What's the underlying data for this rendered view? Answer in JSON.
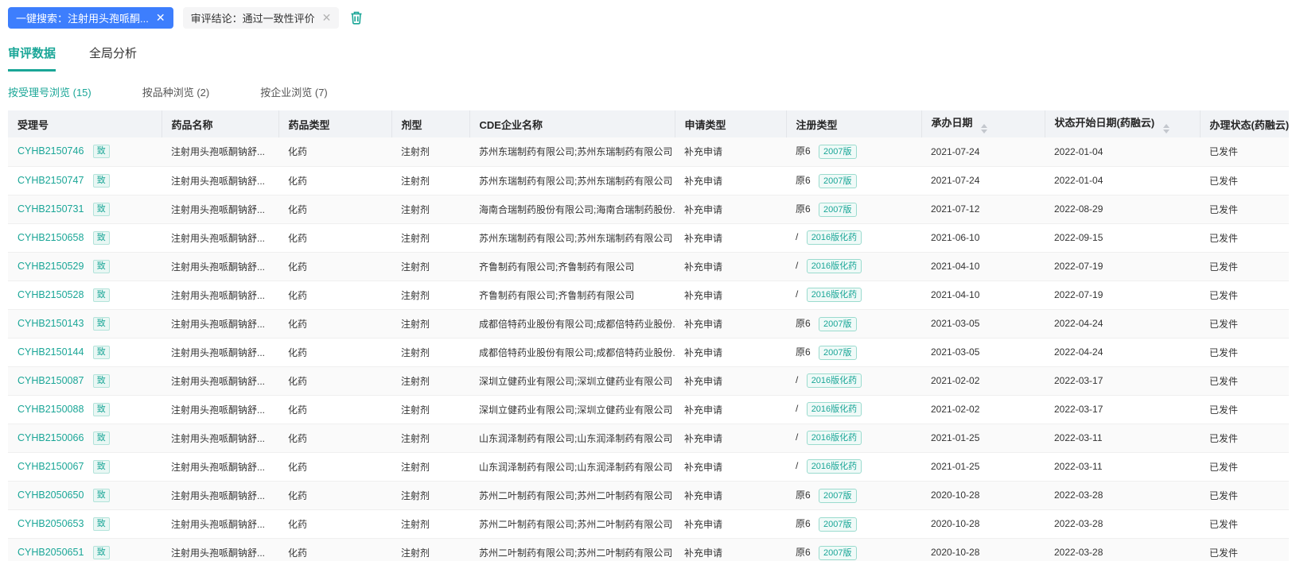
{
  "colors": {
    "accent_teal": "#1AA697",
    "accent_blue": "#3D7EFD"
  },
  "filter_bar": {
    "search_tag": {
      "label": "一键搜索：注射用头孢哌酮...",
      "close": "✕"
    },
    "condition_tag": {
      "label": "审评结论：通过一致性评价",
      "close": "✕"
    },
    "trash_icon": "delete-filters"
  },
  "tabs": [
    {
      "label": "审评数据",
      "active": true
    },
    {
      "label": "全局分析",
      "active": false
    }
  ],
  "subtabs": [
    {
      "label": "按受理号浏览 (15)",
      "active": true
    },
    {
      "label": "按品种浏览 (2)",
      "active": false
    },
    {
      "label": "按企业浏览 (7)",
      "active": false
    }
  ],
  "table": {
    "columns": [
      {
        "label": "受理号"
      },
      {
        "label": "药品名称"
      },
      {
        "label": "药品类型"
      },
      {
        "label": "剂型"
      },
      {
        "label": "CDE企业名称"
      },
      {
        "label": "申请类型"
      },
      {
        "label": "注册类型"
      },
      {
        "label": "承办日期",
        "sortable": true
      },
      {
        "label": "状态开始日期(药融云)",
        "sortable": true
      },
      {
        "label": "办理状态(药融云)"
      }
    ],
    "link_badge": "致",
    "rows": [
      {
        "id": "CYHB2150746",
        "link_badge": "致",
        "name": "注射用头孢哌酮钠舒...",
        "drug_type": "化药",
        "dosage": "注射剂",
        "company": "苏州东瑞制药有限公司;苏州东瑞制药有限公司",
        "app_type": "补充申请",
        "reg_type": "原6",
        "reg_badge": "2007版",
        "accept_date": "2021-07-24",
        "status_date": "2022-01-04",
        "status": "已发件"
      },
      {
        "id": "CYHB2150747",
        "link_badge": "致",
        "name": "注射用头孢哌酮钠舒...",
        "drug_type": "化药",
        "dosage": "注射剂",
        "company": "苏州东瑞制药有限公司;苏州东瑞制药有限公司",
        "app_type": "补充申请",
        "reg_type": "原6",
        "reg_badge": "2007版",
        "accept_date": "2021-07-24",
        "status_date": "2022-01-04",
        "status": "已发件"
      },
      {
        "id": "CYHB2150731",
        "link_badge": "致",
        "name": "注射用头孢哌酮钠舒...",
        "drug_type": "化药",
        "dosage": "注射剂",
        "company": "海南合瑞制药股份有限公司;海南合瑞制药股份...",
        "app_type": "补充申请",
        "reg_type": "原6",
        "reg_badge": "2007版",
        "accept_date": "2021-07-12",
        "status_date": "2022-08-29",
        "status": "已发件"
      },
      {
        "id": "CYHB2150658",
        "link_badge": "致",
        "name": "注射用头孢哌酮钠舒...",
        "drug_type": "化药",
        "dosage": "注射剂",
        "company": "苏州东瑞制药有限公司;苏州东瑞制药有限公司",
        "app_type": "补充申请",
        "reg_type": "/",
        "reg_badge": "2016版化药",
        "accept_date": "2021-06-10",
        "status_date": "2022-09-15",
        "status": "已发件"
      },
      {
        "id": "CYHB2150529",
        "link_badge": "致",
        "name": "注射用头孢哌酮钠舒...",
        "drug_type": "化药",
        "dosage": "注射剂",
        "company": "齐鲁制药有限公司;齐鲁制药有限公司",
        "app_type": "补充申请",
        "reg_type": "/",
        "reg_badge": "2016版化药",
        "accept_date": "2021-04-10",
        "status_date": "2022-07-19",
        "status": "已发件"
      },
      {
        "id": "CYHB2150528",
        "link_badge": "致",
        "name": "注射用头孢哌酮钠舒...",
        "drug_type": "化药",
        "dosage": "注射剂",
        "company": "齐鲁制药有限公司;齐鲁制药有限公司",
        "app_type": "补充申请",
        "reg_type": "/",
        "reg_badge": "2016版化药",
        "accept_date": "2021-04-10",
        "status_date": "2022-07-19",
        "status": "已发件"
      },
      {
        "id": "CYHB2150143",
        "link_badge": "致",
        "name": "注射用头孢哌酮钠舒...",
        "drug_type": "化药",
        "dosage": "注射剂",
        "company": "成都倍特药业股份有限公司;成都倍特药业股份...",
        "app_type": "补充申请",
        "reg_type": "原6",
        "reg_badge": "2007版",
        "accept_date": "2021-03-05",
        "status_date": "2022-04-24",
        "status": "已发件"
      },
      {
        "id": "CYHB2150144",
        "link_badge": "致",
        "name": "注射用头孢哌酮钠舒...",
        "drug_type": "化药",
        "dosage": "注射剂",
        "company": "成都倍特药业股份有限公司;成都倍特药业股份...",
        "app_type": "补充申请",
        "reg_type": "原6",
        "reg_badge": "2007版",
        "accept_date": "2021-03-05",
        "status_date": "2022-04-24",
        "status": "已发件"
      },
      {
        "id": "CYHB2150087",
        "link_badge": "致",
        "name": "注射用头孢哌酮钠舒...",
        "drug_type": "化药",
        "dosage": "注射剂",
        "company": "深圳立健药业有限公司;深圳立健药业有限公司",
        "app_type": "补充申请",
        "reg_type": "/",
        "reg_badge": "2016版化药",
        "accept_date": "2021-02-02",
        "status_date": "2022-03-17",
        "status": "已发件"
      },
      {
        "id": "CYHB2150088",
        "link_badge": "致",
        "name": "注射用头孢哌酮钠舒...",
        "drug_type": "化药",
        "dosage": "注射剂",
        "company": "深圳立健药业有限公司;深圳立健药业有限公司",
        "app_type": "补充申请",
        "reg_type": "/",
        "reg_badge": "2016版化药",
        "accept_date": "2021-02-02",
        "status_date": "2022-03-17",
        "status": "已发件"
      },
      {
        "id": "CYHB2150066",
        "link_badge": "致",
        "name": "注射用头孢哌酮钠舒...",
        "drug_type": "化药",
        "dosage": "注射剂",
        "company": "山东润泽制药有限公司;山东润泽制药有限公司",
        "app_type": "补充申请",
        "reg_type": "/",
        "reg_badge": "2016版化药",
        "accept_date": "2021-01-25",
        "status_date": "2022-03-11",
        "status": "已发件"
      },
      {
        "id": "CYHB2150067",
        "link_badge": "致",
        "name": "注射用头孢哌酮钠舒...",
        "drug_type": "化药",
        "dosage": "注射剂",
        "company": "山东润泽制药有限公司;山东润泽制药有限公司",
        "app_type": "补充申请",
        "reg_type": "/",
        "reg_badge": "2016版化药",
        "accept_date": "2021-01-25",
        "status_date": "2022-03-11",
        "status": "已发件"
      },
      {
        "id": "CYHB2050650",
        "link_badge": "致",
        "name": "注射用头孢哌酮钠舒...",
        "drug_type": "化药",
        "dosage": "注射剂",
        "company": "苏州二叶制药有限公司;苏州二叶制药有限公司",
        "app_type": "补充申请",
        "reg_type": "原6",
        "reg_badge": "2007版",
        "accept_date": "2020-10-28",
        "status_date": "2022-03-28",
        "status": "已发件"
      },
      {
        "id": "CYHB2050653",
        "link_badge": "致",
        "name": "注射用头孢哌酮钠舒...",
        "drug_type": "化药",
        "dosage": "注射剂",
        "company": "苏州二叶制药有限公司;苏州二叶制药有限公司",
        "app_type": "补充申请",
        "reg_type": "原6",
        "reg_badge": "2007版",
        "accept_date": "2020-10-28",
        "status_date": "2022-03-28",
        "status": "已发件"
      },
      {
        "id": "CYHB2050651",
        "link_badge": "致",
        "name": "注射用头孢哌酮钠舒...",
        "drug_type": "化药",
        "dosage": "注射剂",
        "company": "苏州二叶制药有限公司;苏州二叶制药有限公司",
        "app_type": "补充申请",
        "reg_type": "原6",
        "reg_badge": "2007版",
        "accept_date": "2020-10-28",
        "status_date": "2022-03-28",
        "status": "已发件"
      }
    ]
  }
}
